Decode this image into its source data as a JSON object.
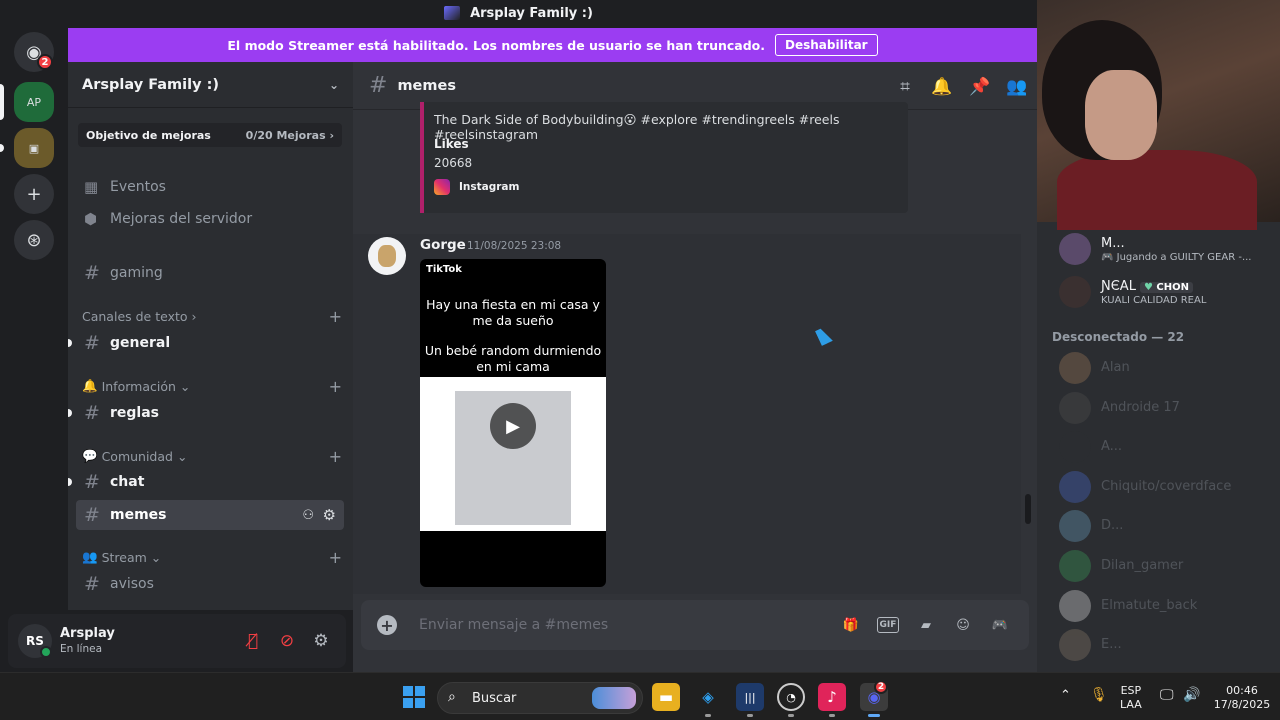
{
  "window": {
    "title": "Arsplay Family :)"
  },
  "rail": {
    "dm_badge": "2"
  },
  "banner": {
    "text": "El modo Streamer está habilitado. Los nombres de usuario se han truncado.",
    "button": "Deshabilitar",
    "color": "#9b3df2"
  },
  "sidebar": {
    "server_name": "Arsplay Family :)",
    "boost_label": "Objetivo de mejoras",
    "boost_count": "0/20 Mejoras",
    "links": [
      "Eventos",
      "Mejoras del servidor"
    ],
    "gaming_channel": "gaming",
    "categories": {
      "texto": "Canales de texto",
      "informacion": "Información",
      "comunidad": "Comunidad",
      "stream": "Stream"
    },
    "channels": {
      "general": "general",
      "reglas": "reglas",
      "chat": "chat",
      "memes": "memes",
      "avisos": "avisos"
    }
  },
  "user": {
    "name": "Arsplay",
    "status": "En línea",
    "avatar_text": "RS"
  },
  "chat": {
    "channel": "memes",
    "embed": {
      "description": "The Dark Side of Bodybuilding😮 #explore #trendingreels #reels #reelsinstagram",
      "field_name": "Likes",
      "field_value": "20668",
      "footer": "Instagram",
      "accent": "#b0206a"
    },
    "message": {
      "author": "Gorge",
      "timestamp": "11/08/2025 23:08",
      "tiktok_brand": "TikTok",
      "caption_1": "Hay una fiesta en mi casa y me da sueño",
      "caption_2": "Un bebé random durmiendo en mi cama"
    },
    "composer_placeholder": "Enviar mensaje a #memes"
  },
  "members": {
    "online": [
      {
        "name": "M...",
        "sub": "Jugando a GUILTY GEAR -..."
      },
      {
        "name": "ƝЄAL",
        "tag": "CHON",
        "sub": "KUALI CALIDAD REAL"
      }
    ],
    "offline_title": "Desconectado — 22",
    "offline": [
      "Alan",
      "Androide 17",
      "A...",
      "Chiquito/coverdface",
      "D...",
      "Dilan_gamer",
      "Elmatute_back",
      "E..."
    ]
  },
  "taskbar": {
    "search": "Buscar",
    "lang_1": "ESP",
    "lang_2": "LAA",
    "time": "00:46",
    "date": "17/8/2025",
    "discord_badge": "2"
  }
}
